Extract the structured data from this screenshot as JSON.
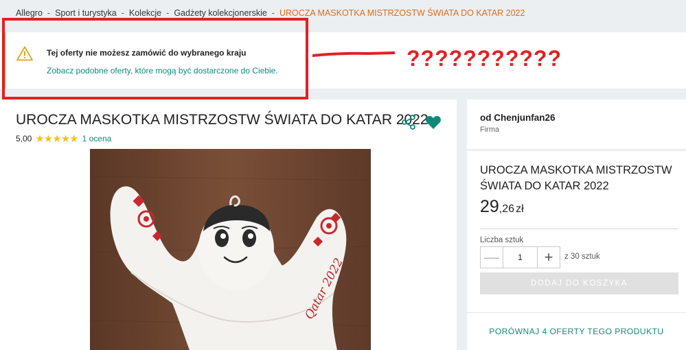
{
  "breadcrumb": {
    "items": [
      "Allegro",
      "Sport i turystyka",
      "Kolekcje",
      "Gadżety kolekcjonerskie"
    ],
    "separator": "-",
    "current": "UROCZA MASKOTKA MISTRZOSTW ŚWIATA DO KATAR 2022"
  },
  "alert": {
    "icon": "warning-triangle-icon",
    "title": "Tej oferty nie możesz zamówić do wybranego kraju",
    "link": "Zobacz podobne oferty, które mogą być dostarczone do Ciebie.",
    "accent_color": "#f0b71d"
  },
  "annotation": {
    "text": "???????????",
    "color": "#e32024"
  },
  "product": {
    "title": "UROCZA MASKOTKA MISTRZOSTW ŚWIATA DO KATAR 2022",
    "rating_value": "5,00",
    "stars": "★★★★★",
    "rating_count": "1 ocena",
    "image_caption": "Qatar 2022",
    "share_icon": "share-icon",
    "favorite_icon": "heart-icon"
  },
  "seller": {
    "name": "od Chenjunfan26",
    "type": "Firma"
  },
  "purchase": {
    "title": "UROCZA MASKOTKA MISTRZOSTW ŚWIATA DO KATAR 2022",
    "price_int": "29",
    "price_dec": ",26",
    "currency": "zł",
    "qty_label": "Liczba sztuk",
    "qty_value": "1",
    "minus": "—",
    "plus": "+",
    "stock": "z 30 sztuk",
    "add_to_cart": "DODAJ DO KOSZYKA",
    "compare": "PORÓWNAJ 4 OFERTY TEGO PRODUKTU"
  },
  "colors": {
    "link": "#11897a",
    "breadcrumb_current": "#e06c19",
    "stars": "#f6c21a"
  }
}
